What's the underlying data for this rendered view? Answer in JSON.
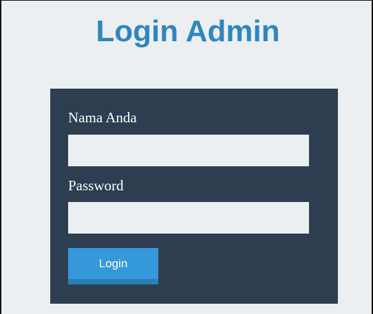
{
  "page": {
    "title": "Login Admin"
  },
  "form": {
    "name_label": "Nama Anda",
    "name_value": "",
    "name_placeholder": "",
    "password_label": "Password",
    "password_value": "",
    "password_placeholder": "",
    "login_label": "Login"
  },
  "colors": {
    "title": "#2e86c1",
    "page_background": "#eceff1",
    "panel_background": "#2d3e50",
    "input_background": "#eceff1",
    "button_background": "#3498db",
    "button_shadow": "#2980b9",
    "label_text": "#ffffff"
  }
}
